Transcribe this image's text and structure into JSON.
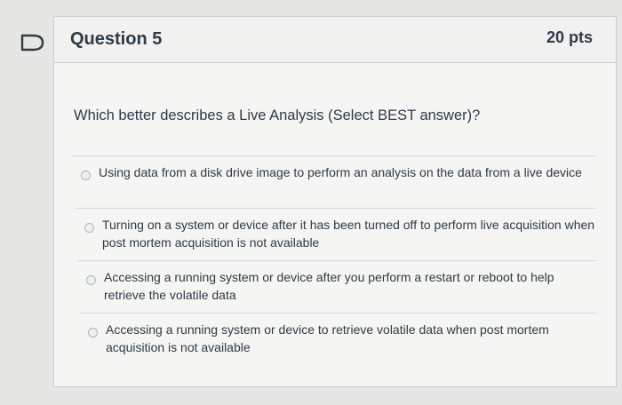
{
  "question": {
    "title": "Question 5",
    "points": "20 pts",
    "prompt": "Which better describes a Live Analysis (Select BEST answer)?"
  },
  "answers": [
    {
      "label": "Using data from a disk drive image to perform an analysis on the data from a live device"
    },
    {
      "label": "Turning on a system or device after it has been turned off to perform live acquisition when post mortem acquisition is not available"
    },
    {
      "label": "Accessing a running system or device after you perform a restart or reboot to help retrieve the volatile data"
    },
    {
      "label": "Accessing a running system or device to retrieve volatile data when post mortem acquisition is not available"
    }
  ],
  "icons": {
    "flag": "flag-question-icon",
    "radio": "radio-unselected-icon"
  },
  "colors": {
    "text": "#2d3b45",
    "border": "#c7cdd1",
    "background": "#f5f5f4"
  }
}
